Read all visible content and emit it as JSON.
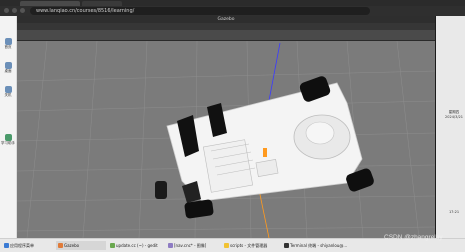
{
  "browser": {
    "url": "www.lanqiao.cn/courses/8516/learning/"
  },
  "sidebar": {
    "items": [
      {
        "label": "首页"
      },
      {
        "label": "桌面"
      },
      {
        "label": "关机"
      },
      {
        "label": "学习助手"
      }
    ]
  },
  "gazebo": {
    "title": "Gazebo",
    "menu": [
      "File",
      "Edit",
      "Camera",
      "View",
      "Window",
      "Help"
    ]
  },
  "right_panel": {
    "time": "17:21",
    "weekday": "星期四",
    "date": "2024/3/21"
  },
  "taskbar": {
    "items": [
      {
        "label": "应用程序菜单",
        "icon": "app-menu-icon"
      },
      {
        "label": "Gazebo",
        "icon": "gazebo-icon"
      },
      {
        "label": "update.cc (~) - gedit",
        "icon": "gedit-icon"
      },
      {
        "label": "[nav.cnc* - 图像]",
        "icon": "image-icon"
      },
      {
        "label": "scripts - 文件管理器",
        "icon": "folder-icon"
      },
      {
        "label": "Terminal 终端 - shiyanlou@...",
        "icon": "terminal-icon"
      }
    ]
  },
  "watermark": "CSDN @zhangrelay",
  "colors": {
    "viewport_bg": "#7b7b7b",
    "grid": "#8e8e8e",
    "robot_body": "#f4f4f4",
    "wheel": "#111111",
    "axis_blue": "#3b3bff",
    "axis_orange": "#ff9a1f"
  }
}
